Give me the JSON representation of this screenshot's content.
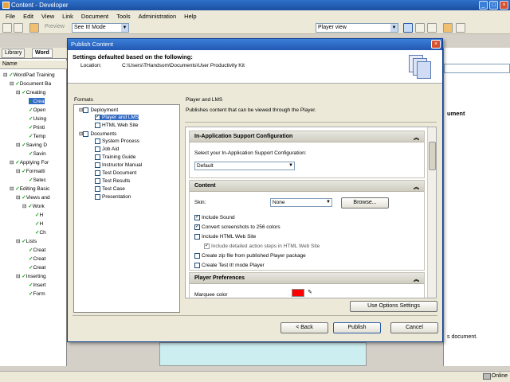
{
  "window": {
    "title": "Content - Developer",
    "online_status": "Online"
  },
  "menu": [
    "File",
    "Edit",
    "View",
    "Link",
    "Document",
    "Tools",
    "Administration",
    "Help"
  ],
  "toolbar": {
    "preview_label": "Preview",
    "mode_combo": "See It! Mode",
    "view_combo": "Player view"
  },
  "left_panel": {
    "tabs": [
      "Library",
      "Word"
    ],
    "column_header": "Name",
    "tree": [
      "WordPad Training",
      "Document Ba",
      "Creating",
      "Crea",
      "Open",
      "Using",
      "Printi",
      "Temp",
      "Saving D",
      "Savin",
      "Applying For",
      "Formatti",
      "Selec",
      "Editing Basic",
      "Views and",
      "Work",
      "H",
      "H",
      "Ch",
      "Lists",
      "Creat",
      "Creat",
      "Creat",
      "Inserting",
      "Insert",
      "Form"
    ]
  },
  "right_panel": {
    "partial_heading": "ument",
    "partial_text": "s document."
  },
  "dialog": {
    "title": "Publish Content",
    "heading": "Settings defaulted based on the following:",
    "location_label": "Location:",
    "location_value": "C:\\Users\\THandsom\\Documents\\User Productivity Kit",
    "formats_label": "Formats",
    "formats_tree": {
      "deployment": "Deployment",
      "deployment_items": [
        "Player and LMS",
        "HTML Web Site"
      ],
      "documents": "Documents",
      "document_items": [
        "System Process",
        "Job Aid",
        "Training Guide",
        "Instructor Manual",
        "Test Document",
        "Test Results",
        "Test Case",
        "Presentation"
      ]
    },
    "panel_title": "Player and LMS",
    "panel_desc": "Publishes content that can be viewed through the Player.",
    "support_section": {
      "header": "In-Application Support Configuration",
      "prompt": "Select your In-Application Support Configuration:",
      "value": "Default"
    },
    "content_section": {
      "header": "Content",
      "skin_label": "Skin:",
      "skin_value": "None",
      "browse_label": "Browse...",
      "options": [
        {
          "label": "Include Sound",
          "checked": true
        },
        {
          "label": "Convert screenshots to 256 colors",
          "checked": true
        },
        {
          "label": "Include HTML Web Site",
          "checked": false
        },
        {
          "label": "Include detailed action steps in HTML Web Site",
          "checked": true
        },
        {
          "label": "Create zip file from published Player package",
          "checked": false
        },
        {
          "label": "Create Test It! mode Player",
          "checked": false
        }
      ]
    },
    "player_prefs": {
      "header": "Player Preferences",
      "marquee_label": "Marquee color",
      "marquee_color": "#ff0000"
    },
    "use_options_label": "Use Options Settings",
    "back_label": "< Back",
    "publish_label": "Publish",
    "cancel_label": "Cancel"
  }
}
